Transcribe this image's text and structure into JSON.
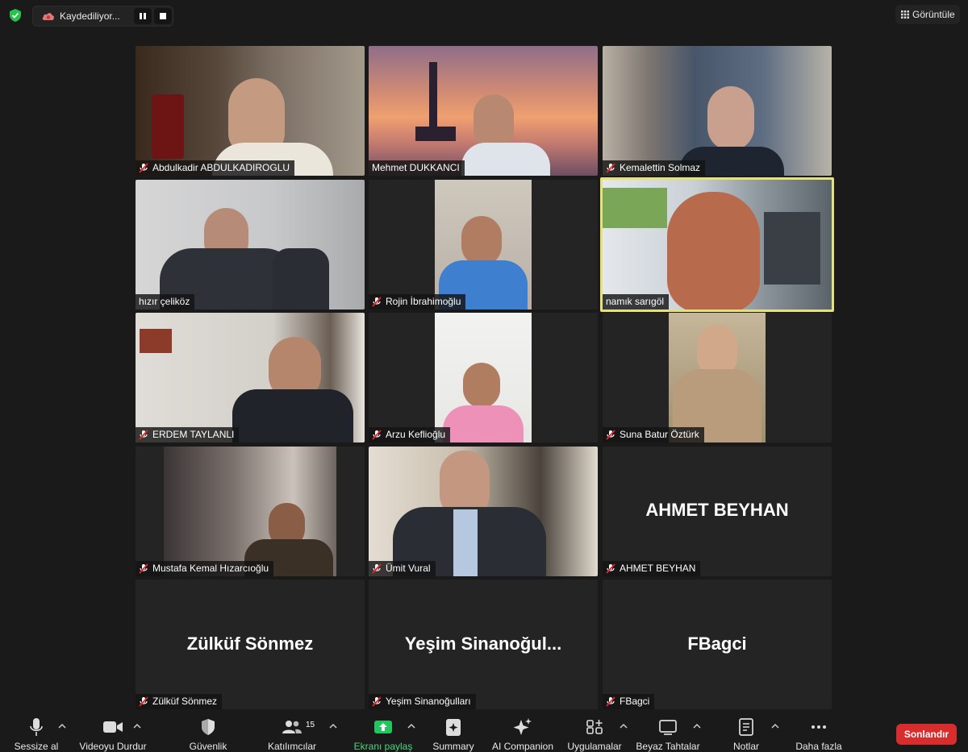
{
  "recording": {
    "status_text": "Kaydediliyor..."
  },
  "view_button": {
    "label": "Görüntüle"
  },
  "participants": [
    {
      "name": "Abdulkadir ABDULKADIROGLU",
      "muted": true
    },
    {
      "name": "Mehmet DUKKANCI",
      "muted": false
    },
    {
      "name": "Kemalettin Solmaz",
      "muted": true
    },
    {
      "name": "hızır çeliköz",
      "muted": false
    },
    {
      "name": "Rojin İbrahimoğlu",
      "muted": true
    },
    {
      "name": "namık sarıgöl",
      "muted": false,
      "active_speaker": true
    },
    {
      "name": "ERDEM TAYLANLI",
      "muted": true
    },
    {
      "name": "Arzu Keflioğlu",
      "muted": true
    },
    {
      "name": "Suna Batur Öztürk",
      "muted": true
    },
    {
      "name": "Mustafa Kemal Hızarcıoğlu",
      "muted": true
    },
    {
      "name": "Ümit Vural",
      "muted": true
    },
    {
      "name": "AHMET BEYHAN",
      "muted": true,
      "display_text": "AHMET BEYHAN"
    },
    {
      "name": "Zülküf Sönmez",
      "muted": true,
      "display_text": "Zülküf Sönmez"
    },
    {
      "name": "Yeşim Sinanoğulları",
      "muted": true,
      "display_text": "Yeşim  Sinanoğul..."
    },
    {
      "name": "FBagci",
      "muted": true,
      "display_text": "FBagci"
    }
  ],
  "toolbar": {
    "mute_label": "Sessize al",
    "video_label": "Videoyu Durdur",
    "security_label": "Güvenlik",
    "participants_label": "Katılımcılar",
    "participants_count": "15",
    "share_label": "Ekranı paylaş",
    "summary_label": "Summary",
    "companion_label": "AI Companion",
    "apps_label": "Uygulamalar",
    "whiteboards_label": "Beyaz Tahtalar",
    "notes_label": "Notlar",
    "more_label": "Daha fazla",
    "end_label": "Sonlandır"
  },
  "colors": {
    "background": "#1a1a1a",
    "tile": "#242424",
    "active_border": "#e6e27a",
    "mic_off": "#e02828",
    "share_green": "#23c55e",
    "end_red": "#d72d2d",
    "secure_green": "#27c24c"
  }
}
